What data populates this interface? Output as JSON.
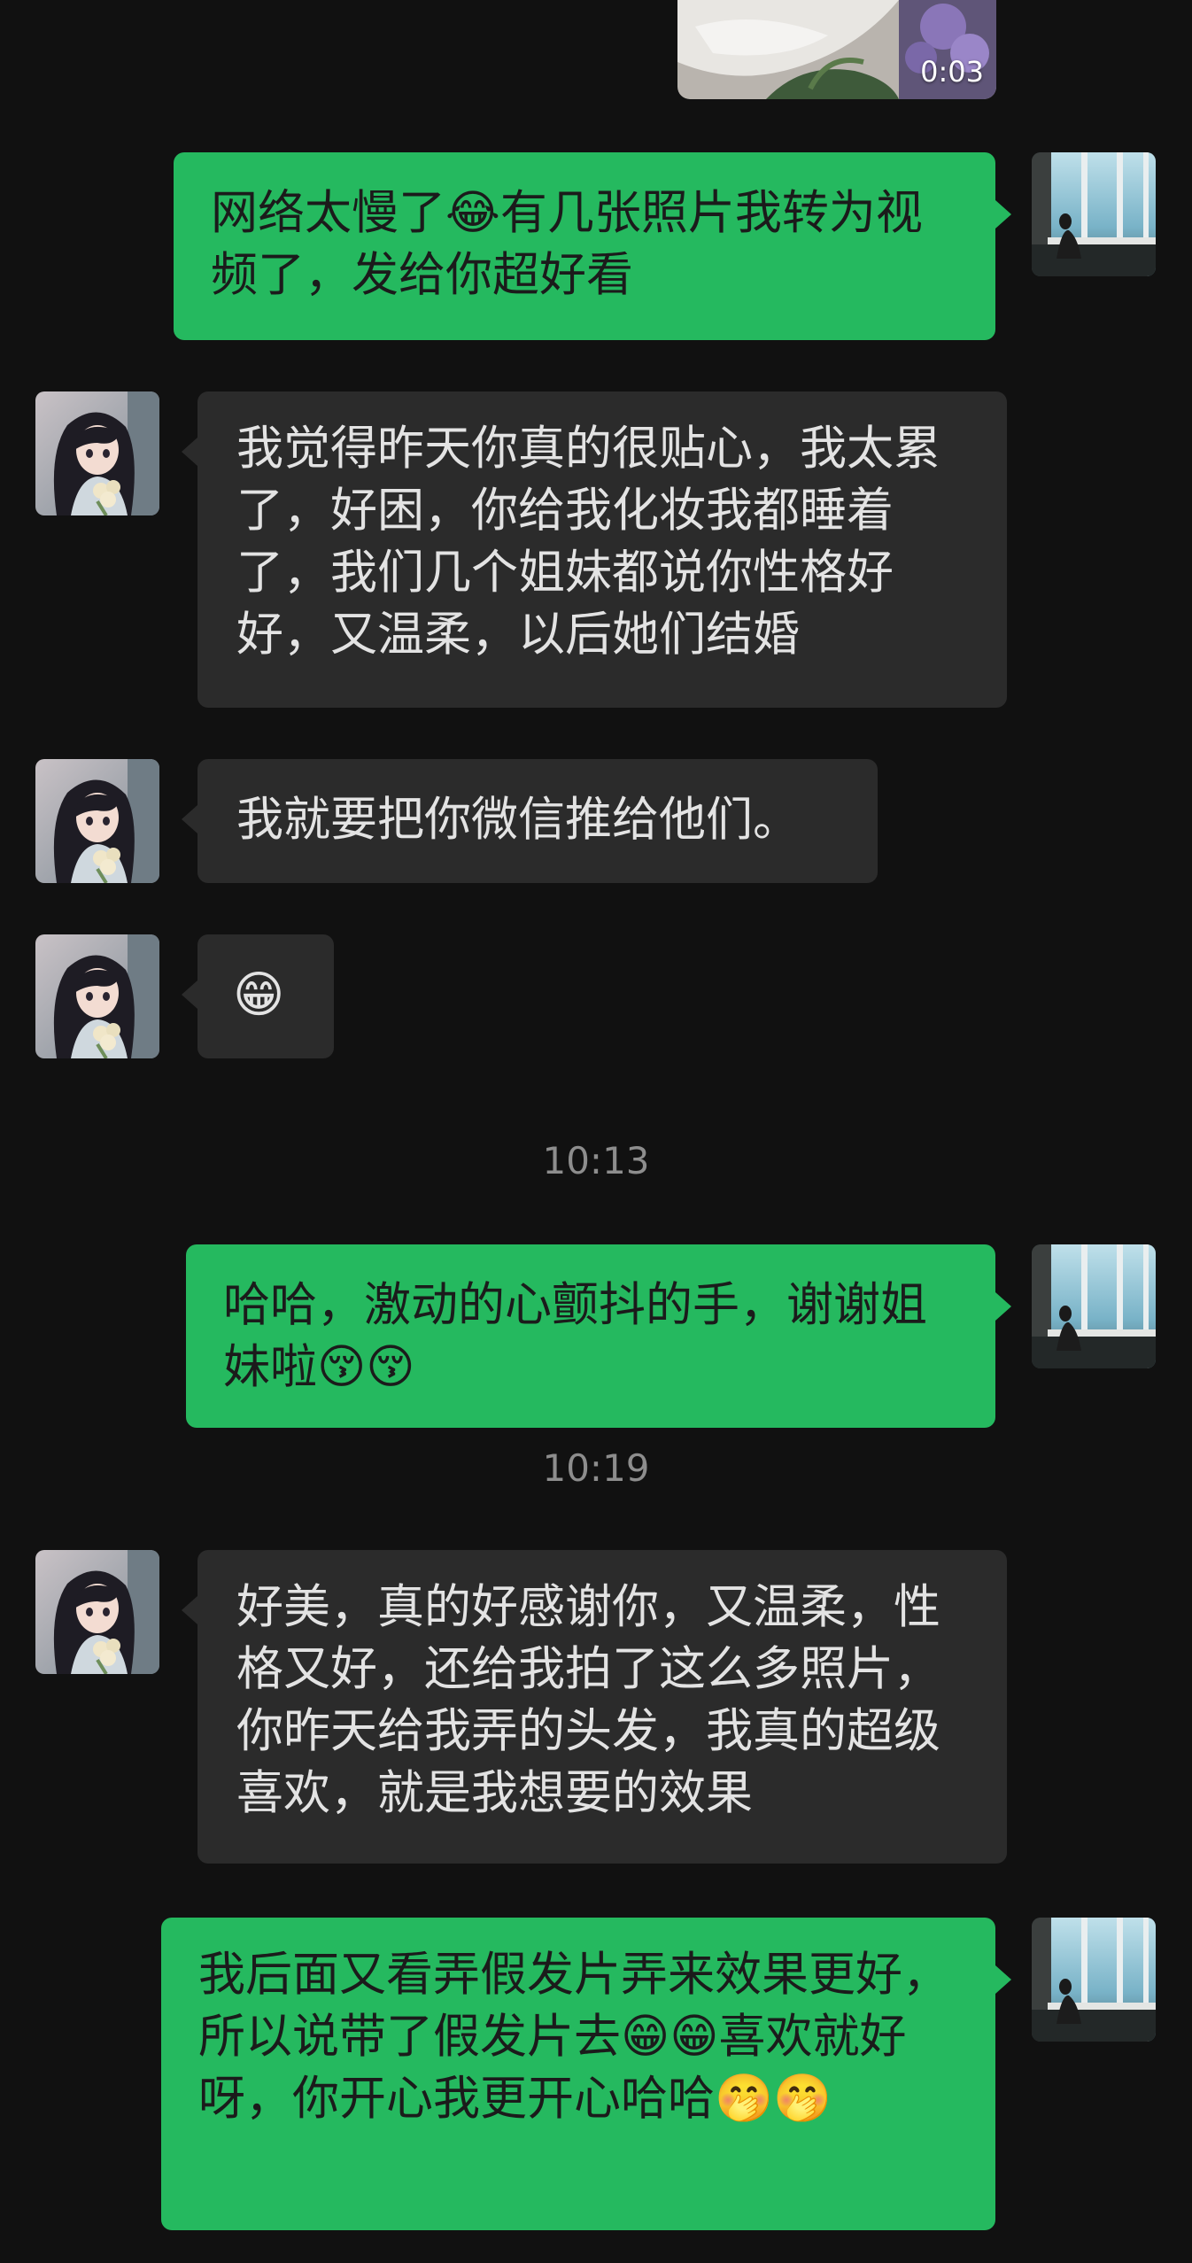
{
  "video": {
    "duration": "0:03"
  },
  "messages": [
    {
      "text": "网络太慢了😂有几张照片我转为视频了，发给你超好看"
    },
    {
      "text": "我觉得昨天你真的很贴心，我太累了，好困，你给我化妆我都睡着了，我们几个姐妹都说你性格好好，又温柔，以后她们结婚"
    },
    {
      "text": "我就要把你微信推给他们。"
    },
    {
      "text": "😁"
    },
    {
      "text": "哈哈，激动的心颤抖的手，谢谢姐妹啦😚😚"
    },
    {
      "text": "好美，真的好感谢你，又温柔，性格又好，还给我拍了这么多照片，你昨天给我弄的头发，我真的超级喜欢，就是我想要的效果"
    },
    {
      "text": "我后面又看弄假发片弄来效果更好，所以说带了假发片去😁😁喜欢就好呀，你开心我更开心哈哈🤭🤭"
    }
  ],
  "timestamps": [
    "10:13",
    "10:19"
  ],
  "colors": {
    "background": "#111111",
    "my_bubble": "#25b95f",
    "their_bubble": "#2b2b2b",
    "timestamp": "#8d8d8d"
  }
}
